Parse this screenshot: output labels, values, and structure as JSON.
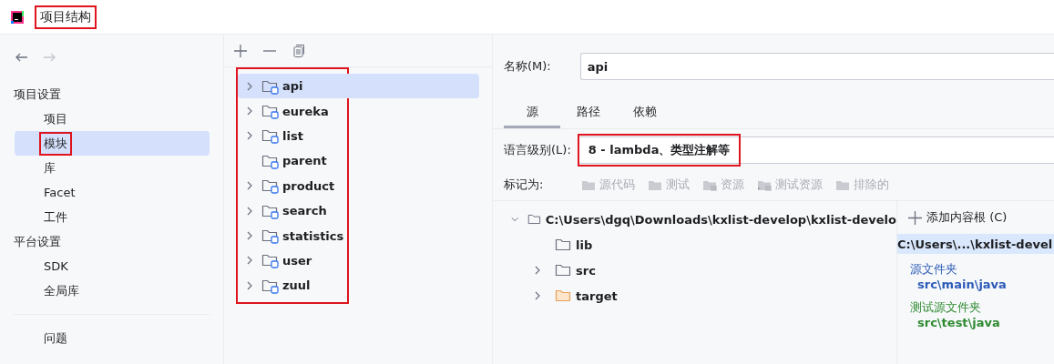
{
  "window": {
    "title": "项目结构",
    "highlighted": true
  },
  "nav": {
    "back": {
      "disabled": false
    },
    "forward": {
      "disabled": true
    }
  },
  "sidebar": {
    "sections": [
      {
        "heading": "项目设置",
        "items": [
          {
            "label": "项目",
            "selected": false,
            "highlighted": false
          },
          {
            "label": "模块",
            "selected": true,
            "highlighted": true
          },
          {
            "label": "库",
            "selected": false,
            "highlighted": false
          },
          {
            "label": "Facet",
            "selected": false,
            "highlighted": false
          },
          {
            "label": "工件",
            "selected": false,
            "highlighted": false
          }
        ]
      },
      {
        "heading": "平台设置",
        "items": [
          {
            "label": "SDK",
            "selected": false,
            "highlighted": false
          },
          {
            "label": "全局库",
            "selected": false,
            "highlighted": false
          }
        ]
      }
    ],
    "footer_items": [
      {
        "label": "问题",
        "selected": false
      }
    ]
  },
  "modules": {
    "highlighted": true,
    "items": [
      {
        "name": "api",
        "expandable": true,
        "selected": true
      },
      {
        "name": "eureka",
        "expandable": true,
        "selected": false
      },
      {
        "name": "list",
        "expandable": true,
        "selected": false
      },
      {
        "name": "parent",
        "expandable": false,
        "selected": false
      },
      {
        "name": "product",
        "expandable": true,
        "selected": false
      },
      {
        "name": "search",
        "expandable": true,
        "selected": false
      },
      {
        "name": "statistics",
        "expandable": true,
        "selected": false
      },
      {
        "name": "user",
        "expandable": true,
        "selected": false
      },
      {
        "name": "zuul",
        "expandable": true,
        "selected": false
      }
    ]
  },
  "details": {
    "name_label": "名称(M):",
    "name_value": "api",
    "tabs": [
      {
        "label": "源",
        "selected": true
      },
      {
        "label": "路径",
        "selected": false
      },
      {
        "label": "依赖",
        "selected": false
      }
    ],
    "language_level": {
      "label": "语言级别(L):",
      "value": "8 - lambda、类型注解等",
      "highlighted": true
    },
    "mark_as": {
      "label": "标记为:",
      "buttons": [
        {
          "label": "源代码",
          "kind": "source"
        },
        {
          "label": "测试",
          "kind": "test"
        },
        {
          "label": "资源",
          "kind": "resources"
        },
        {
          "label": "测试资源",
          "kind": "test-resources"
        },
        {
          "label": "排除的",
          "kind": "excluded"
        }
      ]
    },
    "content_tree": {
      "root": "C:\\Users\\dgq\\Downloads\\kxlist-develop\\kxlist-develo",
      "expanded": true,
      "children": [
        {
          "name": "lib",
          "expandable": false,
          "kind": "plain"
        },
        {
          "name": "src",
          "expandable": true,
          "kind": "plain"
        },
        {
          "name": "target",
          "expandable": true,
          "kind": "excluded"
        }
      ]
    },
    "content_roots": {
      "add_button": "添加内容根 (C)",
      "root": "C:\\Users\\...\\kxlist-devel",
      "groups": [
        {
          "title": "源文件夹",
          "path": "src\\main\\java",
          "kind": "source"
        },
        {
          "title": "测试源文件夹",
          "path": "src\\test\\java",
          "kind": "test"
        }
      ]
    }
  }
}
